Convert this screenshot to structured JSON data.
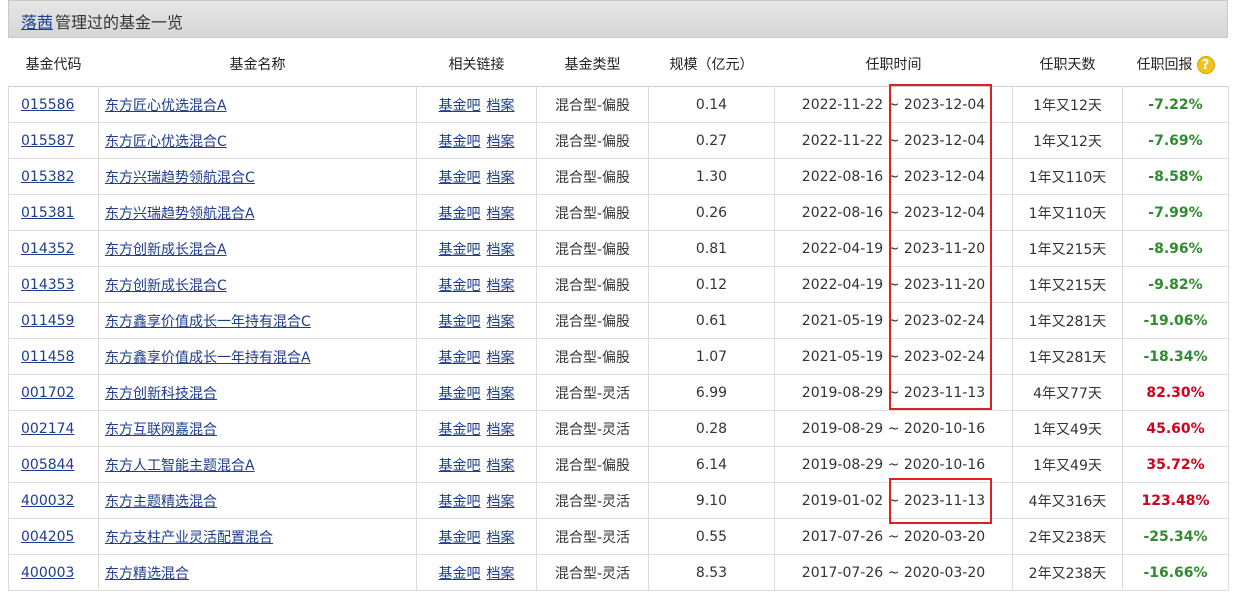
{
  "header": {
    "manager_name": "落茜",
    "title_suffix": "管理过的基金一览"
  },
  "columns": [
    "基金代码",
    "基金名称",
    "相关链接",
    "基金类型",
    "规模（亿元）",
    "任职时间",
    "任职天数",
    "任职回报"
  ],
  "link_labels": {
    "bar": "基金吧",
    "archive": "档案"
  },
  "help_icon": "question-icon",
  "colors": {
    "positive": "#d0021b",
    "negative": "#2e8b2e",
    "highlight": "#e02020"
  },
  "rows": [
    {
      "code": "015586",
      "name": "东方匠心优选混合A",
      "type": "混合型-偏股",
      "size": "0.14",
      "start": "2022-11-22",
      "end": "2023-12-04",
      "days": "1年又12天",
      "ret": "-7.22%"
    },
    {
      "code": "015587",
      "name": "东方匠心优选混合C",
      "type": "混合型-偏股",
      "size": "0.27",
      "start": "2022-11-22",
      "end": "2023-12-04",
      "days": "1年又12天",
      "ret": "-7.69%"
    },
    {
      "code": "015382",
      "name": "东方兴瑞趋势领航混合C",
      "type": "混合型-偏股",
      "size": "1.30",
      "start": "2022-08-16",
      "end": "2023-12-04",
      "days": "1年又110天",
      "ret": "-8.58%"
    },
    {
      "code": "015381",
      "name": "东方兴瑞趋势领航混合A",
      "type": "混合型-偏股",
      "size": "0.26",
      "start": "2022-08-16",
      "end": "2023-12-04",
      "days": "1年又110天",
      "ret": "-7.99%"
    },
    {
      "code": "014352",
      "name": "东方创新成长混合A",
      "type": "混合型-偏股",
      "size": "0.81",
      "start": "2022-04-19",
      "end": "2023-11-20",
      "days": "1年又215天",
      "ret": "-8.96%"
    },
    {
      "code": "014353",
      "name": "东方创新成长混合C",
      "type": "混合型-偏股",
      "size": "0.12",
      "start": "2022-04-19",
      "end": "2023-11-20",
      "days": "1年又215天",
      "ret": "-9.82%"
    },
    {
      "code": "011459",
      "name": "东方鑫享价值成长一年持有混合C",
      "type": "混合型-偏股",
      "size": "0.61",
      "start": "2021-05-19",
      "end": "2023-02-24",
      "days": "1年又281天",
      "ret": "-19.06%"
    },
    {
      "code": "011458",
      "name": "东方鑫享价值成长一年持有混合A",
      "type": "混合型-偏股",
      "size": "1.07",
      "start": "2021-05-19",
      "end": "2023-02-24",
      "days": "1年又281天",
      "ret": "-18.34%"
    },
    {
      "code": "001702",
      "name": "东方创新科技混合",
      "type": "混合型-灵活",
      "size": "6.99",
      "start": "2019-08-29",
      "end": "2023-11-13",
      "days": "4年又77天",
      "ret": "82.30%"
    },
    {
      "code": "002174",
      "name": "东方互联网嘉混合",
      "type": "混合型-灵活",
      "size": "0.28",
      "start": "2019-08-29",
      "end": "2020-10-16",
      "days": "1年又49天",
      "ret": "45.60%"
    },
    {
      "code": "005844",
      "name": "东方人工智能主题混合A",
      "type": "混合型-偏股",
      "size": "6.14",
      "start": "2019-08-29",
      "end": "2020-10-16",
      "days": "1年又49天",
      "ret": "35.72%"
    },
    {
      "code": "400032",
      "name": "东方主题精选混合",
      "type": "混合型-灵活",
      "size": "9.10",
      "start": "2019-01-02",
      "end": "2023-11-13",
      "days": "4年又316天",
      "ret": "123.48%"
    },
    {
      "code": "004205",
      "name": "东方支柱产业灵活配置混合",
      "type": "混合型-灵活",
      "size": "0.55",
      "start": "2017-07-26",
      "end": "2020-03-20",
      "days": "2年又238天",
      "ret": "-25.34%"
    },
    {
      "code": "400003",
      "name": "东方精选混合",
      "type": "混合型-灵活",
      "size": "8.53",
      "start": "2017-07-26",
      "end": "2020-03-20",
      "days": "2年又238天",
      "ret": "-16.66%"
    }
  ]
}
